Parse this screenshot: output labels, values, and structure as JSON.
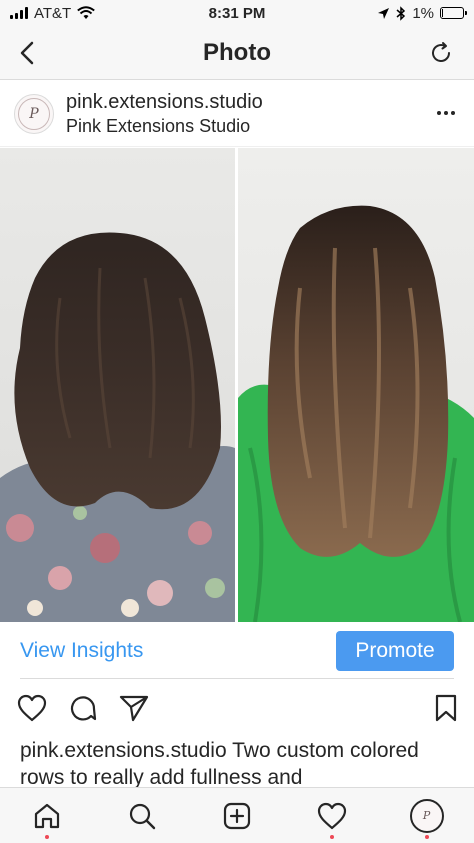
{
  "status_bar": {
    "carrier": "AT&T",
    "time": "8:31 PM",
    "battery": "1%"
  },
  "nav": {
    "title": "Photo",
    "back_icon": "chevron-left-icon",
    "refresh_icon": "refresh-icon"
  },
  "post": {
    "username": "pink.extensions.studio",
    "location": "Pink Extensions Studio",
    "more_icon": "more-horizontal-icon"
  },
  "photo": {
    "left_shirt_color": "#7f8896",
    "right_shirt_color": "#33b552",
    "hair_color": "#3d2b20"
  },
  "insights": {
    "view_label": "View Insights",
    "promote_label": "Promote",
    "accent": "#3897f0"
  },
  "caption": {
    "username": "pink.extensions.studio",
    "text": "Two custom colored rows to really add fullness and"
  },
  "tab_bar": {
    "items": [
      "home-icon",
      "search-icon",
      "add-post-icon",
      "activity-heart-icon",
      "profile-avatar"
    ],
    "notification_color": "#ed4956"
  }
}
